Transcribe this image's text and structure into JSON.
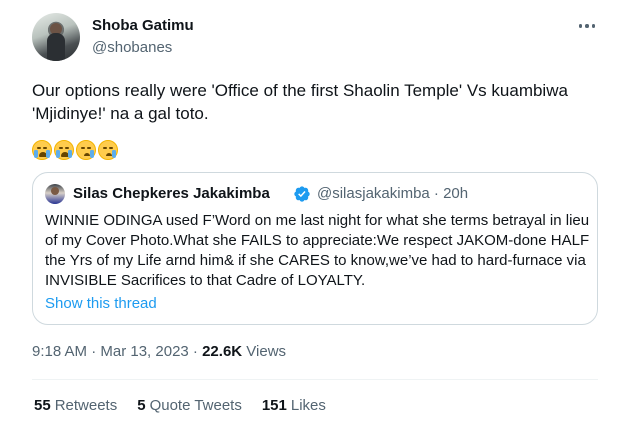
{
  "author": {
    "display_name": "Shoba Gatimu",
    "handle": "@shobanes"
  },
  "tweet": {
    "text": "Our options really were 'Office of the first Shaolin Temple' Vs kuambiwa 'Mjidinye!' na a gal toto.",
    "emojis": [
      "loudly-crying-face",
      "loudly-crying-face",
      "crying-face",
      "crying-face"
    ]
  },
  "quoted_tweet": {
    "display_name": "Silas Chepkeres Jakakimba",
    "verified": true,
    "handle_time": "@silasjakakimba · 20h",
    "text": "WINNIE ODINGA used  F’Word on me last night for what she terms betrayal in lieu of my Cover Photo.What she FAILS to appreciate:We respect JAKOM-done HALF the Yrs of my Life arnd him& if she CARES to know,we’ve had to hard-furnace via INVISIBLE Sacrifices to that Cadre of LOYALTY.",
    "show_thread_label": "Show this thread"
  },
  "meta": {
    "time_date": "9:18 AM · Mar 13, 2023 · ",
    "views_count": "22.6K",
    "views_label": " Views"
  },
  "stats": {
    "retweets_count": "55",
    "retweets_label": "Retweets",
    "quote_tweets_count": "5",
    "quote_tweets_label": "Quote Tweets",
    "likes_count": "151",
    "likes_label": "Likes"
  },
  "colors": {
    "accent": "#1d9bf0",
    "secondary_text": "#536471",
    "border": "#cfd9de"
  }
}
